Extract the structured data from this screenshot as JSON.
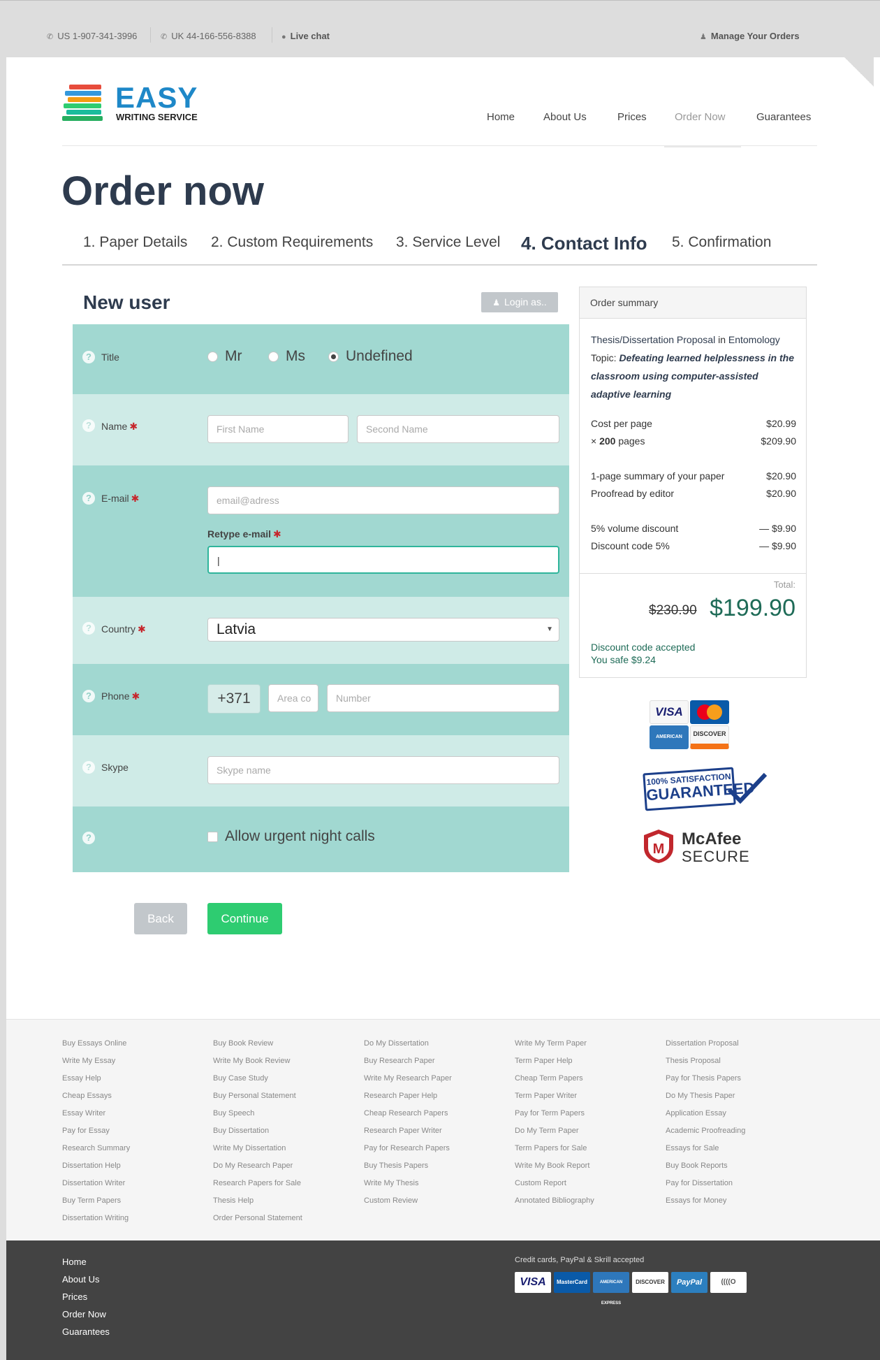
{
  "topbar": {
    "phone_us": "US 1-907-341-3996",
    "phone_uk": "UK 44-166-556-8388",
    "live_chat": "Live chat",
    "manage_orders": "Manage Your Orders"
  },
  "logo": {
    "brand": "EASY",
    "tagline": "WRITING SERVICE"
  },
  "nav": [
    "Home",
    "About Us",
    "Prices",
    "Order Now",
    "Guarantees"
  ],
  "page_title": "Order now",
  "steps": [
    "1. Paper Details",
    "2. Custom Requirements",
    "3. Service Level",
    "4. Contact Info",
    "5. Confirmation"
  ],
  "form": {
    "heading": "New user",
    "login_button": "Login as..",
    "title_label": "Title",
    "title_options": [
      "Mr",
      "Ms",
      "Undefined"
    ],
    "title_selected": "Undefined",
    "name_label": "Name",
    "first_name_placeholder": "First Name",
    "second_name_placeholder": "Second Name",
    "email_label": "E-mail",
    "email_placeholder": "email@adress",
    "retype_label": "Retype e-mail",
    "retype_value": "|",
    "country_label": "Country",
    "country_value": "Latvia",
    "phone_label": "Phone",
    "phone_code": "+371",
    "area_placeholder": "Area co",
    "number_placeholder": "Number",
    "skype_label": "Skype",
    "skype_placeholder": "Skype name",
    "night_calls_label": "Allow urgent night calls",
    "required_mark": "✱",
    "back_button": "Back",
    "continue_button": "Continue"
  },
  "summary": {
    "heading": "Order summary",
    "paper_type": "Thesis/Dissertation Proposal",
    "in_word": "in",
    "subject": "Entomology",
    "topic_label": "Topic:",
    "topic": "Defeating learned helplessness in the classroom using computer-assisted adaptive learning",
    "cost_per_page_label": "Cost per page",
    "cost_per_page": "$20.99",
    "pages_prefix": "× ",
    "pages_count": "200",
    "pages_suffix": " pages",
    "pages_total": "$209.90",
    "summary_label": "1-page summary of your paper",
    "summary_cost": "$20.90",
    "proofread_label": "Proofread by editor",
    "proofread_cost": "$20.90",
    "volume_label": "5% volume discount",
    "volume_cost": "— $9.90",
    "code_label": "Discount code 5%",
    "code_cost": "— $9.90",
    "total_label": "Total:",
    "old_total": "$230.90",
    "new_total": "$199.90",
    "discount_accepted": "Discount code accepted",
    "you_safe": "You safe $9.24"
  },
  "badges": {
    "visa": "VISA",
    "mastercard": "MasterCard",
    "amex": "AMERICAN EXPRESS",
    "discover": "DISCOVER",
    "guarantee_line1": "100% SATISFACTION",
    "guarantee_line2": "GUARANTEED",
    "mcafee_line1": "McAfee",
    "mcafee_line2": "SECURE"
  },
  "footer": {
    "columns": [
      [
        "Buy Essays Online",
        "Write My Essay",
        "Essay Help",
        "Cheap Essays",
        "Essay Writer",
        "Pay for Essay",
        "Research Summary",
        "Dissertation Help",
        "Dissertation Writer",
        "Buy Term Papers",
        "Dissertation Writing"
      ],
      [
        "Buy Book Review",
        "Write My Book Review",
        "Buy Case Study",
        "Buy Personal Statement",
        "Buy Speech",
        "Buy Dissertation",
        "Write My Dissertation",
        "Do My Research Paper",
        "Research Papers for Sale",
        "Thesis Help",
        "Order Personal Statement"
      ],
      [
        "Do My Dissertation",
        "Buy Research Paper",
        "Write My Research Paper",
        "Research Paper Help",
        "Cheap Research Papers",
        "Research Paper Writer",
        "Pay for Research Papers",
        "Buy Thesis Papers",
        "Write My Thesis",
        "Custom Review"
      ],
      [
        "Write My Term Paper",
        "Term Paper Help",
        "Cheap Term Papers",
        "Term Paper Writer",
        "Pay for Term Papers",
        "Do My Term Paper",
        "Term Papers for Sale",
        "Write My Book Report",
        "Custom Report",
        "Annotated Bibliography"
      ],
      [
        "Dissertation Proposal",
        "Thesis Proposal",
        "Pay for Thesis Papers",
        "Do My Thesis Paper",
        "Application Essay",
        "Academic Proofreading",
        "Essays for Sale",
        "Buy Book Reports",
        "Pay for Dissertation",
        "Essays for Money"
      ]
    ],
    "nav": [
      "Home",
      "About Us",
      "Prices",
      "Order Now",
      "Guarantees"
    ],
    "payments_title": "Credit cards, PayPal & Skrill accepted",
    "payment_cards": [
      "VISA",
      "MasterCard",
      "AMERICAN EXPRESS",
      "DISCOVER",
      "PayPal",
      "((((O"
    ]
  },
  "colors": {
    "accent": "#2ecc71",
    "row_dark": "#a1d8d1",
    "row_light": "#cfebe7",
    "title": "#2e3b4e",
    "total": "#1e6b57"
  }
}
